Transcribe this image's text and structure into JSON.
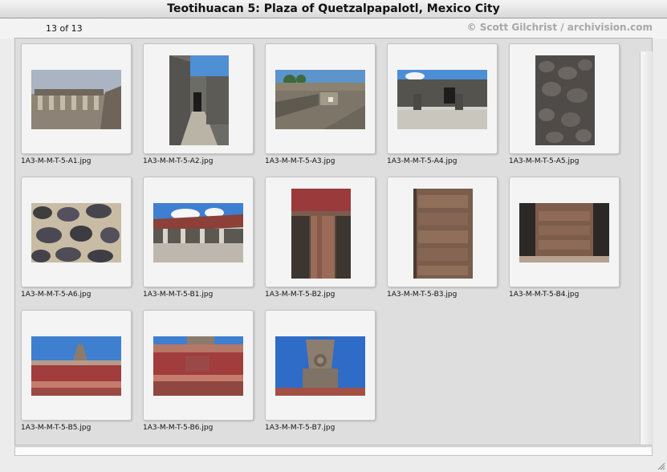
{
  "window": {
    "title": "Teotihuacan 5: Plaza of Quetzalpapalotl, Mexico City"
  },
  "toolbar": {
    "counter": "13 of 13",
    "credit": "© Scott Gilchrist / archivision.com"
  },
  "thumbnails": [
    {
      "filename": "1A3-M-M-T-5-A1.jpg",
      "subject": "colonnaded-building-photo"
    },
    {
      "filename": "1A3-M-M-T-5-A2.jpg",
      "subject": "stone-corridor-photo"
    },
    {
      "filename": "1A3-M-M-T-5-A3.jpg",
      "subject": "stone-ruins-overview-photo"
    },
    {
      "filename": "1A3-M-M-T-5-A4.jpg",
      "subject": "stone-walls-doorway-photo"
    },
    {
      "filename": "1A3-M-M-T-5-A5.jpg",
      "subject": "stone-wall-closeup-photo"
    },
    {
      "filename": "1A3-M-M-T-5-A6.jpg",
      "subject": "stone-mosaic-texture-photo"
    },
    {
      "filename": "1A3-M-M-T-5-B1.jpg",
      "subject": "courtyard-colonnade-photo"
    },
    {
      "filename": "1A3-M-M-T-5-B2.jpg",
      "subject": "carved-pillar-photo"
    },
    {
      "filename": "1A3-M-M-T-5-B3.jpg",
      "subject": "carved-stone-pillar-photo"
    },
    {
      "filename": "1A3-M-M-T-5-B4.jpg",
      "subject": "carved-relief-photo"
    },
    {
      "filename": "1A3-M-M-T-5-B5.jpg",
      "subject": "red-frieze-merlon-photo"
    },
    {
      "filename": "1A3-M-M-T-5-B6.jpg",
      "subject": "red-frieze-closeup-photo"
    },
    {
      "filename": "1A3-M-M-T-5-B7.jpg",
      "subject": "stone-merlon-sky-photo"
    }
  ]
}
